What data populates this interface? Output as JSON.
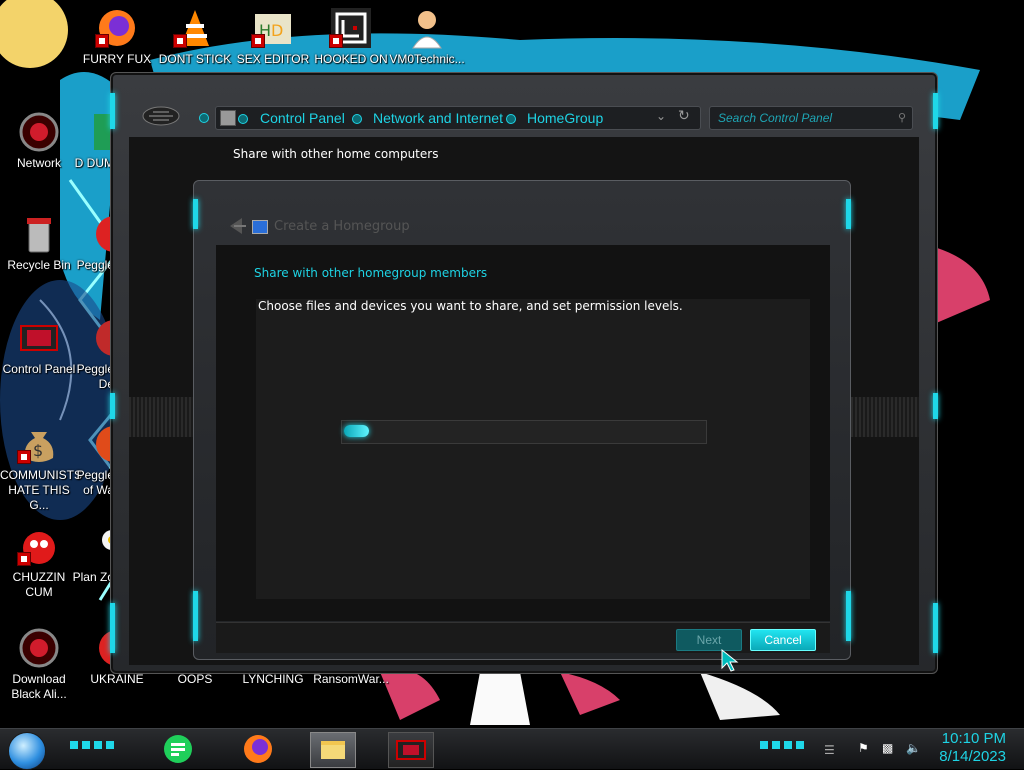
{
  "desktop": {
    "icons_top": [
      {
        "label": "FURRY FUX"
      },
      {
        "label": "DONT STICK"
      },
      {
        "label": "SEX EDITOR"
      },
      {
        "label": "HOOKED ON"
      },
      {
        "label": "VM0Technic..."
      }
    ],
    "icons_left": [
      {
        "label": "Network"
      },
      {
        "label": "Recycle Bin"
      },
      {
        "label": "Control Panel"
      },
      {
        "label": "COMMUNISTS HATE THIS G..."
      },
      {
        "label": "CHUZZIN CUM"
      },
      {
        "label": "Download Black Ali..."
      }
    ],
    "icons_col2": [
      {
        "label": "D DUM"
      },
      {
        "label": "Peggle"
      },
      {
        "label": "Peggle De"
      },
      {
        "label": "Peggle of Wa"
      },
      {
        "label": "Plan Zo"
      },
      {
        "label": "UKRAINE"
      }
    ],
    "icons_bottom": [
      {
        "label": "OOPS"
      },
      {
        "label": "LYNCHING"
      },
      {
        "label": "RansomWar..."
      }
    ]
  },
  "control_panel": {
    "breadcrumb": [
      "Control Panel",
      "Network and Internet",
      "HomeGroup"
    ],
    "search_placeholder": "Search Control Panel",
    "heading": "Share with other home computers"
  },
  "dialog": {
    "title": "Create a Homegroup",
    "heading": "Share with other homegroup members",
    "subtext": "Choose files and devices you want to share, and set permission levels.",
    "progress_fraction": 0.07,
    "next_label": "Next",
    "cancel_label": "Cancel"
  },
  "taskbar": {
    "time": "10:10 PM",
    "date": "8/14/2023"
  },
  "colors": {
    "accent": "#1ed3e4"
  }
}
